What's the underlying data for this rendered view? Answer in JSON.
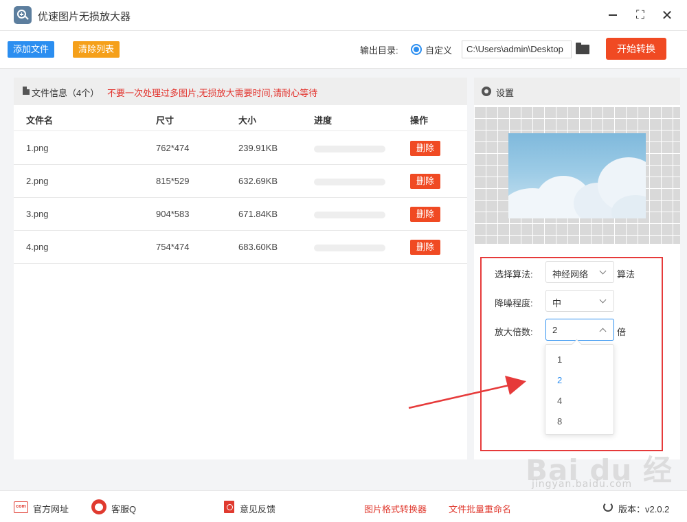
{
  "app": {
    "title": "优速图片无损放大器"
  },
  "toolbar": {
    "add_label": "添加文件",
    "clear_label": "清除列表",
    "output_label": "输出目录:",
    "radio_label": "自定义",
    "path_value": "C:\\Users\\admin\\Desktop",
    "start_label": "开始转换"
  },
  "file_info": {
    "title": "文件信息（4个）",
    "warning": "不要一次处理过多图片,无损放大需要时间,请耐心等待",
    "columns": [
      "文件名",
      "尺寸",
      "大小",
      "进度",
      "操作"
    ],
    "delete_label": "删除",
    "rows": [
      {
        "name": "1.png",
        "size": "762*474",
        "filesize": "239.91KB",
        "progress": 0
      },
      {
        "name": "2.png",
        "size": "815*529",
        "filesize": "632.69KB",
        "progress": 0
      },
      {
        "name": "3.png",
        "size": "904*583",
        "filesize": "671.84KB",
        "progress": 0
      },
      {
        "name": "4.png",
        "size": "754*474",
        "filesize": "683.60KB",
        "progress": 0
      }
    ]
  },
  "settings": {
    "title": "设置",
    "algorithm_label": "选择算法:",
    "algorithm_value": "神经网络",
    "algorithm_suffix": "算法",
    "denoise_label": "降噪程度:",
    "denoise_value": "中",
    "scale_label": "放大倍数:",
    "scale_value": "2",
    "scale_suffix": "倍",
    "scale_options": [
      "1",
      "2",
      "4",
      "8"
    ],
    "scale_selected": "2"
  },
  "footer": {
    "website": "官方网址",
    "service": "客服Q",
    "feedback": "意见反馈",
    "converter": "图片格式转换器",
    "rename": "文件批量重命名",
    "version": "版本：v2.0.2",
    "com_text": "com"
  },
  "watermark": {
    "text": "Bai du 经验",
    "sub": "jingyan.baidu.com"
  },
  "colors": {
    "accent": "#2b8ef0",
    "danger": "#f04a23",
    "warning": "#f5a01a",
    "frame": "#e63a3a"
  }
}
